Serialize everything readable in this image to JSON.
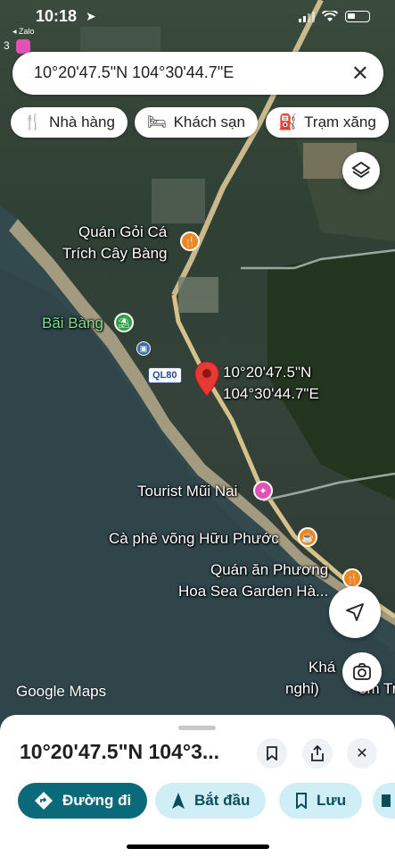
{
  "status_bar": {
    "time": "10:18",
    "back_app": "◂ Zalo"
  },
  "search": {
    "query": "10°20'47.5\"N 104°30'44.7\"E",
    "badge": "3"
  },
  "chips": [
    {
      "icon": "fork-knife-icon",
      "label": "Nhà hàng"
    },
    {
      "icon": "bed-icon",
      "label": "Khách sạn"
    },
    {
      "icon": "fuel-pump-icon",
      "label": "Trạm xăng"
    }
  ],
  "map": {
    "labels": {
      "quan_goi_ca_1": "Quán Gỏi Cá",
      "quan_goi_ca_2": "Trích Cây Bàng",
      "bai_bang": "Bãi Bàng",
      "road": "QL80",
      "pin_1": "10°20'47.5\"N",
      "pin_2": "104°30'44.7\"E",
      "tourist": "Tourist Mũi Nai",
      "ca_phe": "Cà phê võng Hữu Phước",
      "quan_an_1": "Quán ăn Phương",
      "quan_an_2": "Hoa Sea Garden Hà...",
      "khach_1": "Khá",
      "khach_2": "nghỉ)",
      "khach_3": "em Tr",
      "logo": "Google Maps"
    }
  },
  "sheet": {
    "title": "10°20'47.5\"N 104°3...",
    "actions": [
      {
        "label": "Đường đi"
      },
      {
        "label": "Bắt đầu"
      },
      {
        "label": "Lưu"
      }
    ]
  },
  "colors": {
    "primary": "#0b6a7a",
    "secondary_bg": "#cfeef6",
    "pin": "#e53935"
  }
}
